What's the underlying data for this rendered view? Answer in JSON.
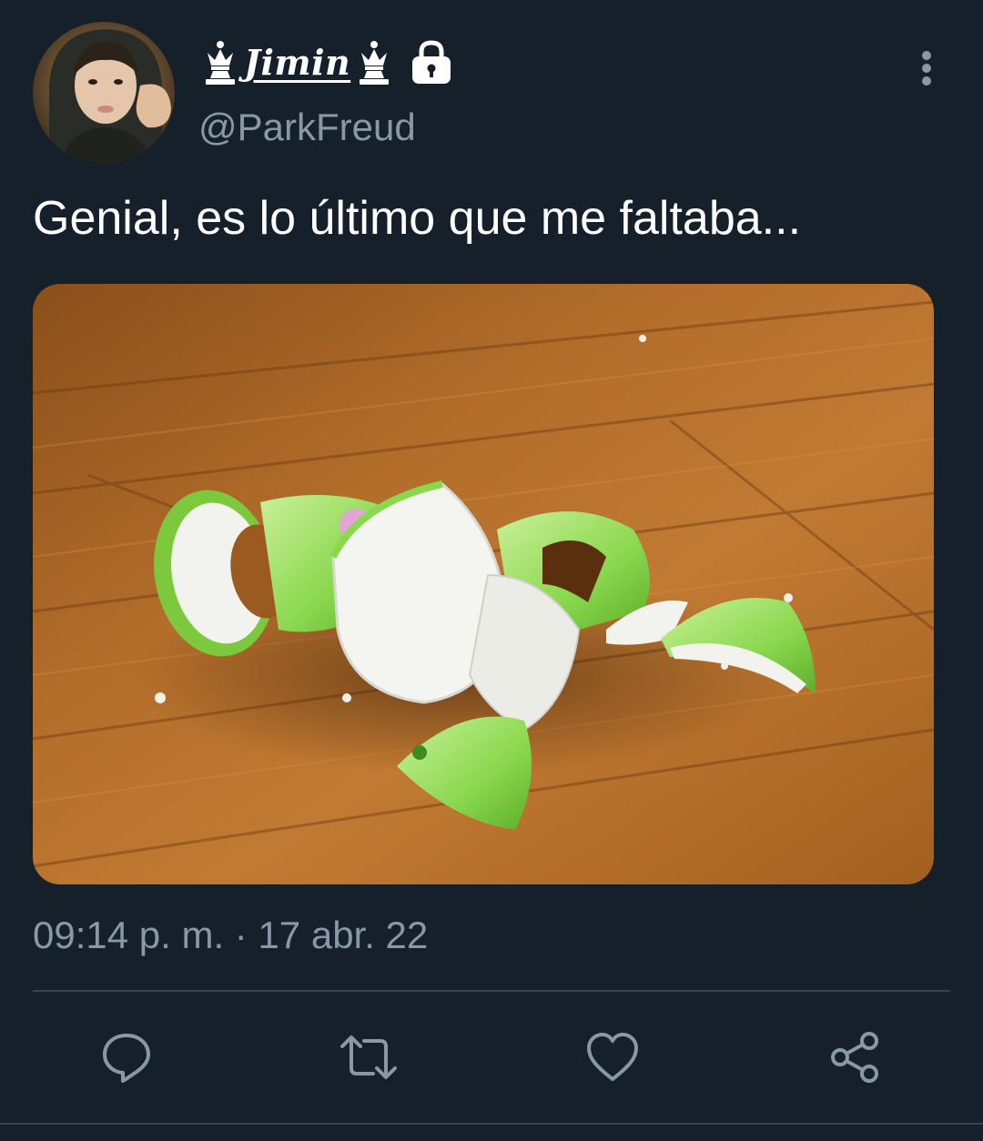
{
  "author": {
    "display_name": "Jimin",
    "handle": "@ParkFreud",
    "decorations": [
      "chess-queen-icon",
      "chess-queen-icon"
    ],
    "protected_icon": "lock-icon"
  },
  "tweet": {
    "text": "Genial, es lo último que me faltaba...",
    "timestamp": "09:14 p. m. · 17 abr. 22",
    "media_description_icon": "broken-teapot-photo"
  },
  "actions": {
    "reply_icon": "reply-icon",
    "retweet_icon": "retweet-icon",
    "like_icon": "heart-icon",
    "share_icon": "share-icon"
  },
  "colors": {
    "background": "#15202b",
    "secondary_text": "#8899a6",
    "divider": "#38444d"
  }
}
